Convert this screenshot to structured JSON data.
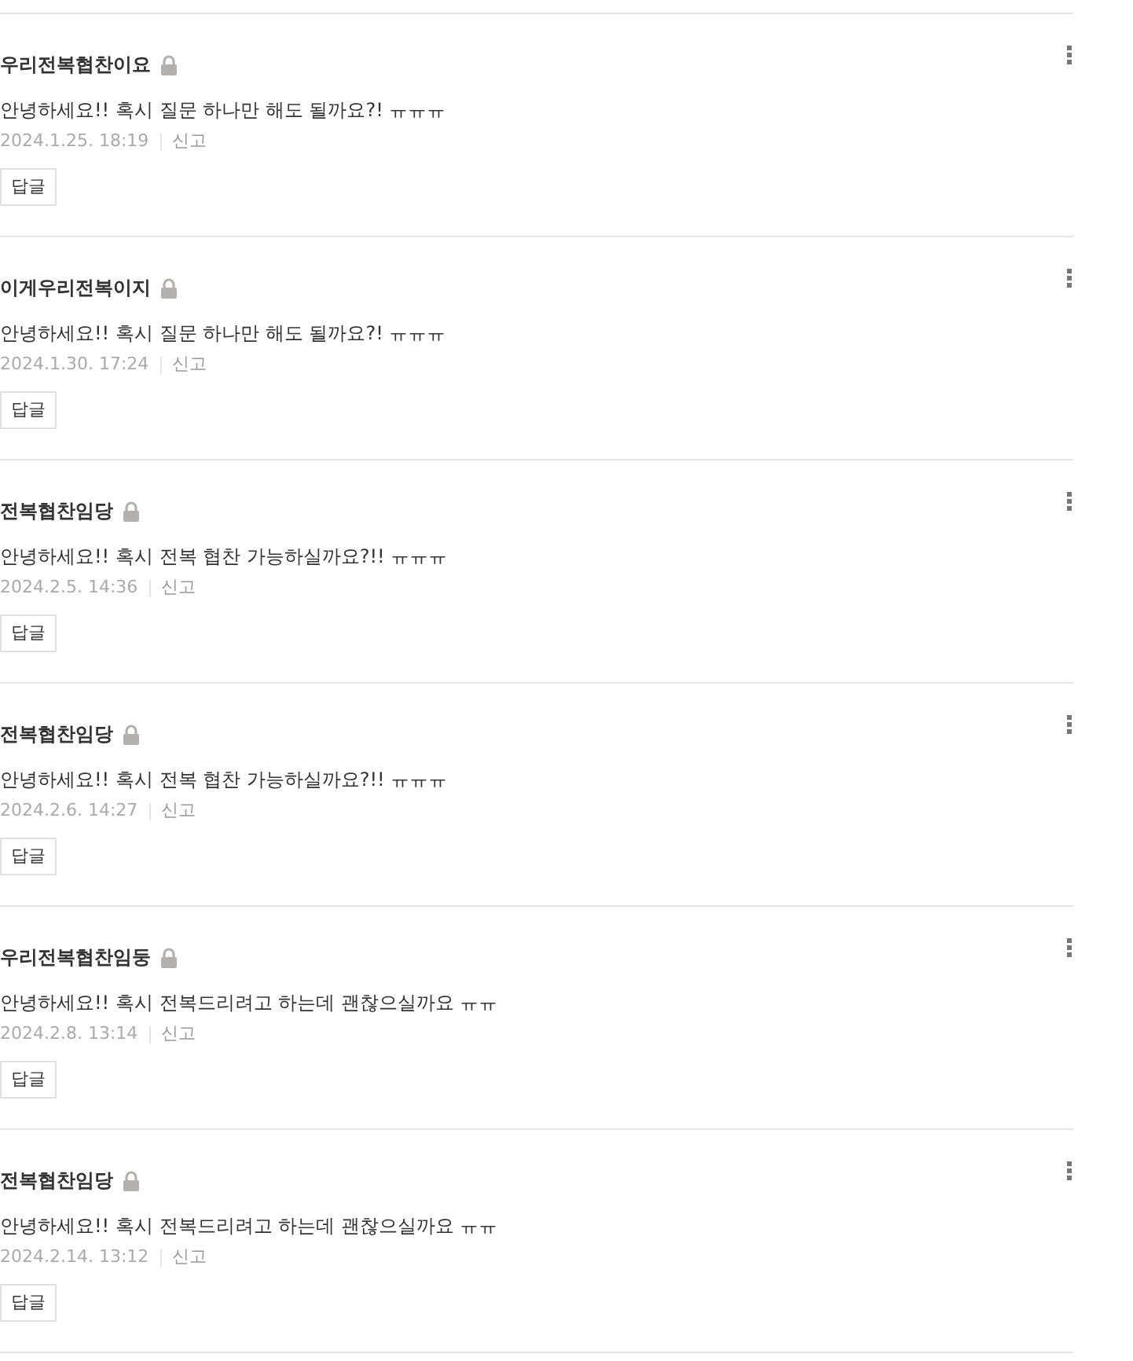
{
  "comments": [
    {
      "author": "우리전복협찬이요",
      "locked": true,
      "text": "안녕하세요!! 혹시 질문 하나만 해도 될까요?! ㅠㅠㅠ",
      "date": "2024.1.25. 18:19",
      "report": "신고",
      "reply": "답글"
    },
    {
      "author": "이게우리전복이지",
      "locked": true,
      "text": "안녕하세요!! 혹시 질문 하나만 해도 될까요?! ㅠㅠㅠ",
      "date": "2024.1.30. 17:24",
      "report": "신고",
      "reply": "답글"
    },
    {
      "author": "전복협찬임당",
      "locked": true,
      "text": "안녕하세요!! 혹시 전복 협찬 가능하실까요?!! ㅠㅠㅠ",
      "date": "2024.2.5. 14:36",
      "report": "신고",
      "reply": "답글"
    },
    {
      "author": "전복협찬임당",
      "locked": true,
      "text": "안녕하세요!! 혹시 전복 협찬 가능하실까요?!! ㅠㅠㅠ",
      "date": "2024.2.6. 14:27",
      "report": "신고",
      "reply": "답글"
    },
    {
      "author": "우리전복협찬임둥",
      "locked": true,
      "text": "안녕하세요!! 혹시 전복드리려고 하는데 괜찮으실까요 ㅠㅠ",
      "date": "2024.2.8. 13:14",
      "report": "신고",
      "reply": "답글"
    },
    {
      "author": "전복협찬임당",
      "locked": true,
      "text": "안녕하세요!! 혹시 전복드리려고 하는데 괜찮으실까요 ㅠㅠ",
      "date": "2024.2.14. 13:12",
      "report": "신고",
      "reply": "답글"
    }
  ]
}
